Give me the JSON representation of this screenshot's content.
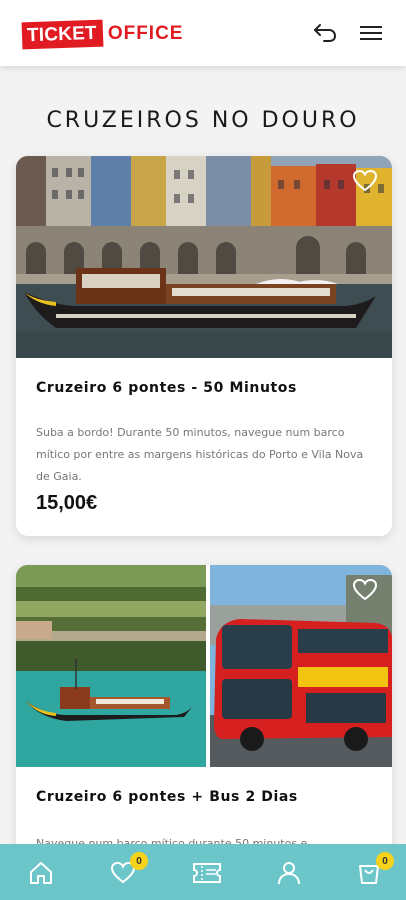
{
  "header": {
    "logo_ticket": "TICKET",
    "logo_office": "OFFICE",
    "back_icon": "return-arrow-icon",
    "menu_icon": "hamburger-menu-icon"
  },
  "page": {
    "title": "CRUZEIROS NO DOURO"
  },
  "cards": [
    {
      "title": "Cruzeiro 6 pontes - 50 Minutos",
      "description": "Suba a bordo! Durante 50 minutos, navegue num barco mítico por entre as margens históricas do Porto e Vila Nova de Gaia.",
      "price": "15,00€",
      "favorite_icon": "heart-outline-icon"
    },
    {
      "title": "Cruzeiro 6 pontes + Bus 2 Dias",
      "description": "Navegue num barco mítico durante 50 minutos e",
      "favorite_icon": "heart-outline-icon"
    }
  ],
  "bottom_nav": {
    "items": [
      {
        "icon": "home-icon"
      },
      {
        "icon": "heart-icon",
        "badge": "0"
      },
      {
        "icon": "ticket-icon"
      },
      {
        "icon": "user-icon"
      },
      {
        "icon": "cart-icon",
        "badge": "0"
      }
    ]
  },
  "colors": {
    "brand_red": "#e11b22",
    "nav_teal": "#6cc5c9",
    "badge_yellow": "#f7d21a"
  }
}
